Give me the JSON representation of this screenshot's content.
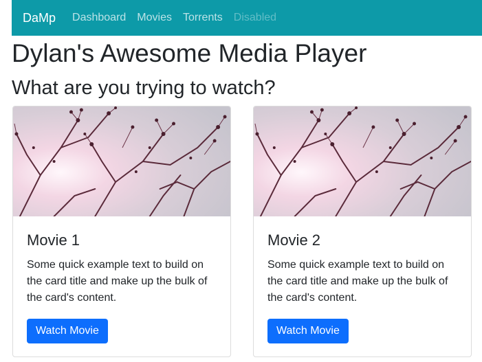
{
  "navbar": {
    "brand": "DaMp",
    "links": [
      {
        "label": "Dashboard",
        "state": "normal"
      },
      {
        "label": "Movies",
        "state": "normal"
      },
      {
        "label": "Torrents",
        "state": "normal"
      },
      {
        "label": "Disabled",
        "state": "disabled"
      }
    ],
    "bg_color": "#0d9aa8"
  },
  "page": {
    "title": "Dylan's Awesome Media Player",
    "subtitle": "What are you trying to watch?"
  },
  "cards": [
    {
      "image_icon": "blossom-branches-image",
      "title": "Movie 1",
      "text": "Some quick example text to build on the card title and make up the bulk of the card's content.",
      "button_label": "Watch Movie"
    },
    {
      "image_icon": "blossom-branches-image",
      "title": "Movie 2",
      "text": "Some quick example text to build on the card title and make up the bulk of the card's content.",
      "button_label": "Watch Movie"
    }
  ],
  "colors": {
    "primary_button": "#0d6efd",
    "text": "#212529"
  }
}
